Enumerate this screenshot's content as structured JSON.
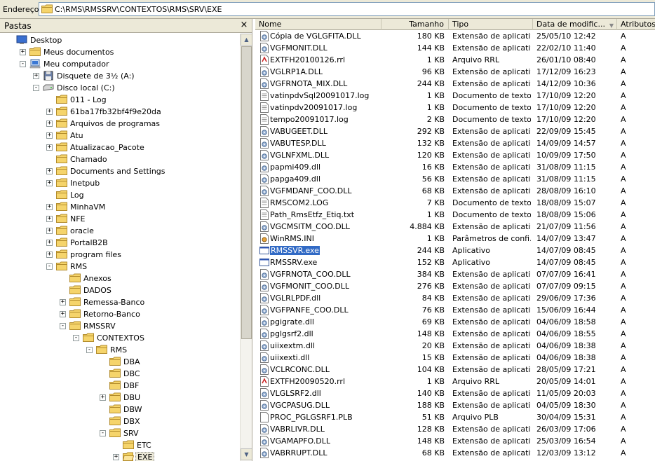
{
  "address": {
    "label": "Endereço",
    "path": "C:\\RMS\\RMSSRV\\CONTEXTOS\\RMS\\SRV\\EXE"
  },
  "folders_pane": {
    "title": "Pastas",
    "close": "×",
    "tree": [
      {
        "label": "Desktop",
        "icon": "desktop-icon"
      },
      {
        "label": "Meus documentos",
        "icon": "folder-icon"
      },
      {
        "label": "Meu computador",
        "icon": "computer-icon"
      },
      {
        "label": "Disquete de 3½ (A:)",
        "icon": "floppy-icon"
      },
      {
        "label": "Disco local (C:)",
        "icon": "drive-icon"
      },
      {
        "label": "011 - Log",
        "icon": "folder-icon"
      },
      {
        "label": "61ba17fb32bf4f9e20da",
        "icon": "folder-icon"
      },
      {
        "label": "Arquivos de programas",
        "icon": "folder-icon"
      },
      {
        "label": "Atu",
        "icon": "folder-icon"
      },
      {
        "label": "Atualizacao_Pacote",
        "icon": "folder-icon"
      },
      {
        "label": "Chamado",
        "icon": "folder-icon"
      },
      {
        "label": "Documents and Settings",
        "icon": "folder-icon"
      },
      {
        "label": "Inetpub",
        "icon": "folder-icon"
      },
      {
        "label": "Log",
        "icon": "folder-icon"
      },
      {
        "label": "MinhaVM",
        "icon": "folder-icon"
      },
      {
        "label": "NFE",
        "icon": "folder-icon"
      },
      {
        "label": "oracle",
        "icon": "folder-icon"
      },
      {
        "label": "PortalB2B",
        "icon": "folder-icon"
      },
      {
        "label": "program files",
        "icon": "folder-icon"
      },
      {
        "label": "RMS",
        "icon": "folder-icon"
      },
      {
        "label": "Anexos",
        "icon": "folder-icon"
      },
      {
        "label": "DADOS",
        "icon": "folder-icon"
      },
      {
        "label": "Remessa-Banco",
        "icon": "folder-icon"
      },
      {
        "label": "Retorno-Banco",
        "icon": "folder-icon"
      },
      {
        "label": "RMSSRV",
        "icon": "folder-icon"
      },
      {
        "label": "CONTEXTOS",
        "icon": "folder-icon"
      },
      {
        "label": "RMS",
        "icon": "folder-icon"
      },
      {
        "label": "DBA",
        "icon": "folder-icon"
      },
      {
        "label": "DBC",
        "icon": "folder-icon"
      },
      {
        "label": "DBF",
        "icon": "folder-icon"
      },
      {
        "label": "DBU",
        "icon": "folder-icon"
      },
      {
        "label": "DBW",
        "icon": "folder-icon"
      },
      {
        "label": "DBX",
        "icon": "folder-icon"
      },
      {
        "label": "SRV",
        "icon": "folder-icon"
      },
      {
        "label": "ETC",
        "icon": "folder-icon"
      },
      {
        "label": "EXE",
        "icon": "folder-open-icon"
      }
    ]
  },
  "file_list": {
    "columns": [
      "Nome",
      "Tamanho",
      "Tipo",
      "Data de modific...",
      "Atributos"
    ],
    "sort_indicator": "▼",
    "files": [
      {
        "name": "Cópia de VGLGFITA.DLL",
        "size": "180 KB",
        "type": "Extensão de aplicativo",
        "date": "25/05/10 12:42",
        "attr": "A",
        "icon": "dll-icon"
      },
      {
        "name": "VGFMONIT.DLL",
        "size": "144 KB",
        "type": "Extensão de aplicativo",
        "date": "22/02/10 11:40",
        "attr": "A",
        "icon": "dll-icon"
      },
      {
        "name": "EXTFH20100126.rrl",
        "size": "1 KB",
        "type": "Arquivo RRL",
        "date": "26/01/10 08:40",
        "attr": "A",
        "icon": "rrl-icon"
      },
      {
        "name": "VGLRP1A.DLL",
        "size": "96 KB",
        "type": "Extensão de aplicativo",
        "date": "17/12/09 16:23",
        "attr": "A",
        "icon": "dll-icon"
      },
      {
        "name": "VGFRNOTA_MIX.DLL",
        "size": "244 KB",
        "type": "Extensão de aplicativo",
        "date": "14/12/09 10:36",
        "attr": "A",
        "icon": "dll-icon"
      },
      {
        "name": "vatinpdvSql20091017.log",
        "size": "1 KB",
        "type": "Documento de texto",
        "date": "17/10/09 12:20",
        "attr": "A",
        "icon": "text-icon"
      },
      {
        "name": "vatinpdv20091017.log",
        "size": "1 KB",
        "type": "Documento de texto",
        "date": "17/10/09 12:20",
        "attr": "A",
        "icon": "text-icon"
      },
      {
        "name": "tempo20091017.log",
        "size": "2 KB",
        "type": "Documento de texto",
        "date": "17/10/09 12:20",
        "attr": "A",
        "icon": "text-icon"
      },
      {
        "name": "VABUGEET.DLL",
        "size": "292 KB",
        "type": "Extensão de aplicativo",
        "date": "22/09/09 15:45",
        "attr": "A",
        "icon": "dll-icon"
      },
      {
        "name": "VABUTESP.DLL",
        "size": "132 KB",
        "type": "Extensão de aplicativo",
        "date": "14/09/09 14:57",
        "attr": "A",
        "icon": "dll-icon"
      },
      {
        "name": "VGLNFXML.DLL",
        "size": "120 KB",
        "type": "Extensão de aplicativo",
        "date": "10/09/09 17:50",
        "attr": "A",
        "icon": "dll-icon"
      },
      {
        "name": "papmi409.dll",
        "size": "16 KB",
        "type": "Extensão de aplicativo",
        "date": "31/08/09 11:15",
        "attr": "A",
        "icon": "dll-icon"
      },
      {
        "name": "papga409.dll",
        "size": "56 KB",
        "type": "Extensão de aplicativo",
        "date": "31/08/09 11:15",
        "attr": "A",
        "icon": "dll-icon"
      },
      {
        "name": "VGFMDANF_COO.DLL",
        "size": "68 KB",
        "type": "Extensão de aplicativo",
        "date": "28/08/09 16:10",
        "attr": "A",
        "icon": "dll-icon"
      },
      {
        "name": "RMSCOM2.LOG",
        "size": "7 KB",
        "type": "Documento de texto",
        "date": "18/08/09 15:07",
        "attr": "A",
        "icon": "text-icon"
      },
      {
        "name": "Path_RmsEtfz_Etiq.txt",
        "size": "1 KB",
        "type": "Documento de texto",
        "date": "18/08/09 15:06",
        "attr": "A",
        "icon": "text-icon"
      },
      {
        "name": "VGCMSITM_COO.DLL",
        "size": "4.884 KB",
        "type": "Extensão de aplicativo",
        "date": "21/07/09 11:56",
        "attr": "A",
        "icon": "dll-icon"
      },
      {
        "name": "WinRMS.INI",
        "size": "1 KB",
        "type": "Parâmetros de confi...",
        "date": "14/07/09 13:47",
        "attr": "A",
        "icon": "ini-icon"
      },
      {
        "name": "RMSSVR.exe",
        "size": "244 KB",
        "type": "Aplicativo",
        "date": "14/07/09 08:45",
        "attr": "A",
        "icon": "exe-icon",
        "selected": true
      },
      {
        "name": "RMSSRV.exe",
        "size": "152 KB",
        "type": "Aplicativo",
        "date": "14/07/09 08:45",
        "attr": "A",
        "icon": "exe-icon"
      },
      {
        "name": "VGFRNOTA_COO.DLL",
        "size": "384 KB",
        "type": "Extensão de aplicativo",
        "date": "07/07/09 16:41",
        "attr": "A",
        "icon": "dll-icon"
      },
      {
        "name": "VGFMONIT_COO.DLL",
        "size": "276 KB",
        "type": "Extensão de aplicativo",
        "date": "07/07/09 09:15",
        "attr": "A",
        "icon": "dll-icon"
      },
      {
        "name": "VGLRLPDF.dll",
        "size": "84 KB",
        "type": "Extensão de aplicativo",
        "date": "29/06/09 17:36",
        "attr": "A",
        "icon": "dll-icon"
      },
      {
        "name": "VGFPANFE_COO.DLL",
        "size": "76 KB",
        "type": "Extensão de aplicativo",
        "date": "15/06/09 16:44",
        "attr": "A",
        "icon": "dll-icon"
      },
      {
        "name": "pgigrate.dll",
        "size": "69 KB",
        "type": "Extensão de aplicativo",
        "date": "04/06/09 18:58",
        "attr": "A",
        "icon": "dll-icon"
      },
      {
        "name": "pglgsrf2.dll",
        "size": "148 KB",
        "type": "Extensão de aplicativo",
        "date": "04/06/09 18:55",
        "attr": "A",
        "icon": "dll-icon"
      },
      {
        "name": "uiixextm.dll",
        "size": "20 KB",
        "type": "Extensão de aplicativo",
        "date": "04/06/09 18:38",
        "attr": "A",
        "icon": "dll-icon"
      },
      {
        "name": "uiixexti.dll",
        "size": "15 KB",
        "type": "Extensão de aplicativo",
        "date": "04/06/09 18:38",
        "attr": "A",
        "icon": "dll-icon"
      },
      {
        "name": "VCLRCONC.DLL",
        "size": "104 KB",
        "type": "Extensão de aplicativo",
        "date": "28/05/09 17:21",
        "attr": "A",
        "icon": "dll-icon"
      },
      {
        "name": "EXTFH20090520.rrl",
        "size": "1 KB",
        "type": "Arquivo RRL",
        "date": "20/05/09 14:01",
        "attr": "A",
        "icon": "rrl-icon"
      },
      {
        "name": "VLGLSRF2.dll",
        "size": "140 KB",
        "type": "Extensão de aplicativo",
        "date": "11/05/09 20:03",
        "attr": "A",
        "icon": "dll-icon"
      },
      {
        "name": "VGCPASUG.DLL",
        "size": "188 KB",
        "type": "Extensão de aplicativo",
        "date": "04/05/09 18:30",
        "attr": "A",
        "icon": "dll-icon"
      },
      {
        "name": "PROC_PGLGSRF1.PLB",
        "size": "51 KB",
        "type": "Arquivo PLB",
        "date": "30/04/09 15:31",
        "attr": "A",
        "icon": "file-icon"
      },
      {
        "name": "VABRLIVR.DLL",
        "size": "128 KB",
        "type": "Extensão de aplicativo",
        "date": "26/03/09 17:06",
        "attr": "A",
        "icon": "dll-icon"
      },
      {
        "name": "VGAMAPFO.DLL",
        "size": "148 KB",
        "type": "Extensão de aplicativo",
        "date": "25/03/09 16:54",
        "attr": "A",
        "icon": "dll-icon"
      },
      {
        "name": "VABRRUPT.DLL",
        "size": "68 KB",
        "type": "Extensão de aplicativo",
        "date": "12/03/09 13:12",
        "attr": "A",
        "icon": "dll-icon"
      }
    ]
  }
}
